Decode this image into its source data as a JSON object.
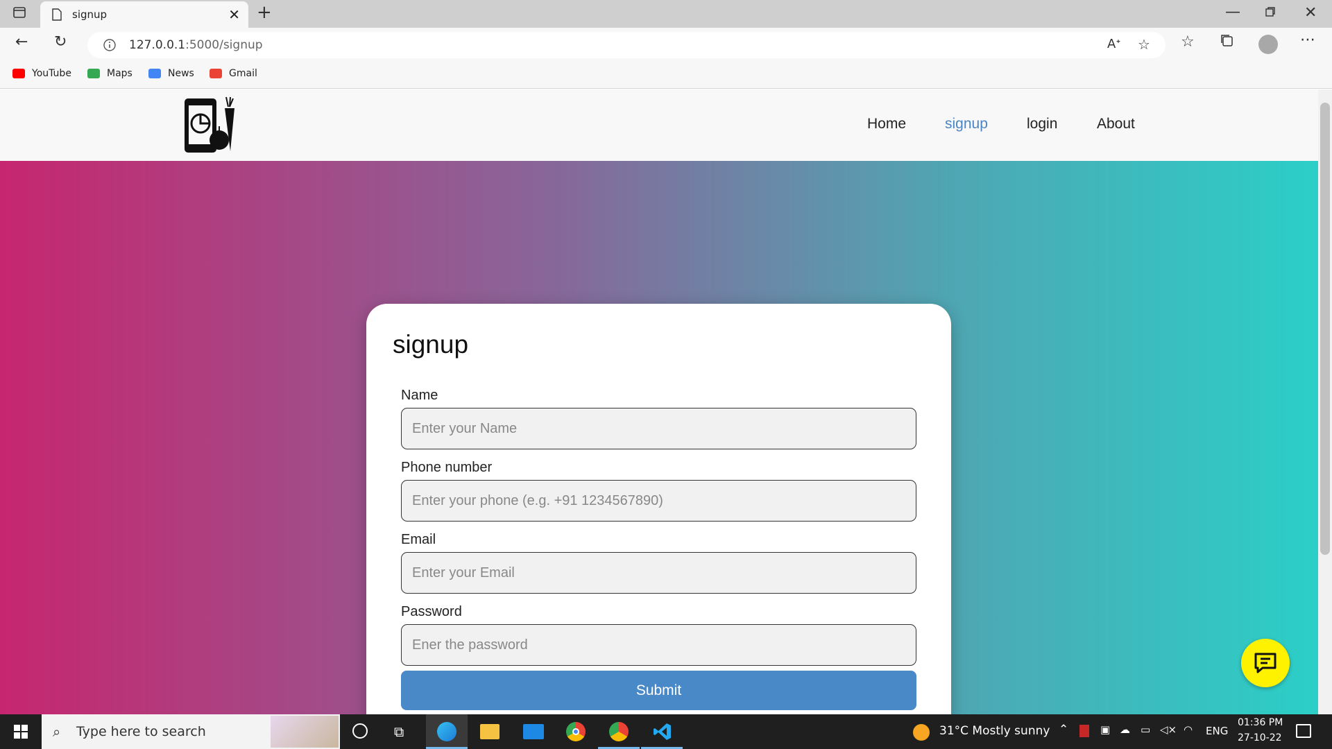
{
  "browser": {
    "tab_title": "signup",
    "url_host": "127.0.0.1",
    "url_rest": ":5000/signup",
    "bookmarks": [
      {
        "label": "YouTube",
        "color": "#ff0000"
      },
      {
        "label": "Maps",
        "color": "#34a853"
      },
      {
        "label": "News",
        "color": "#4285f4"
      },
      {
        "label": "Gmail",
        "color": "#ea4335"
      }
    ]
  },
  "navbar": {
    "links": [
      "Home",
      "signup",
      "login",
      "About"
    ],
    "active_color": "#4a86c5"
  },
  "form": {
    "title": "signup",
    "fields": [
      {
        "label": "Name",
        "placeholder": "Enter your Name"
      },
      {
        "label": "Phone number",
        "placeholder": "Enter your phone (e.g. +91 1234567890)"
      },
      {
        "label": "Email",
        "placeholder": "Enter your Email"
      },
      {
        "label": "Password",
        "placeholder": "Ener the password"
      }
    ],
    "submit_label": "Submit"
  },
  "taskbar": {
    "search_placeholder": "Type here to search",
    "weather": "31°C  Mostly sunny",
    "language": "ENG",
    "time": "01:36 PM",
    "date": "27-10-22"
  }
}
